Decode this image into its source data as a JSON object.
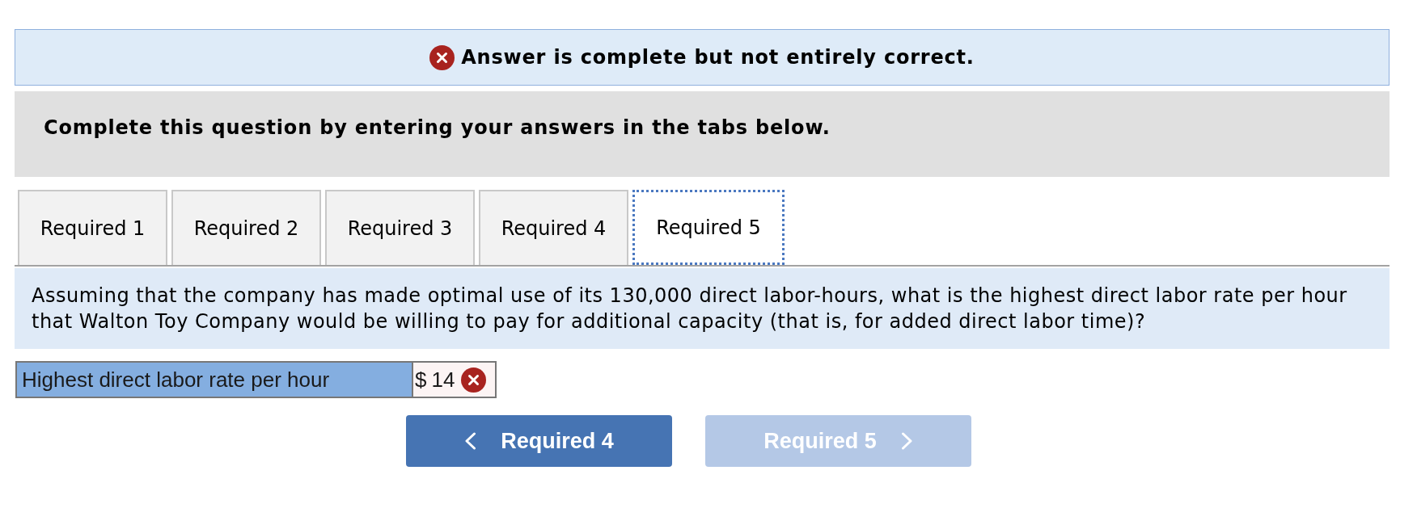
{
  "feedback_banner": {
    "correct": false,
    "message": "Answer is complete but not entirely correct."
  },
  "instructions": "Complete this question by entering your answers in the tabs below.",
  "tabs": [
    {
      "label": "Required 1",
      "selected": false
    },
    {
      "label": "Required 2",
      "selected": false
    },
    {
      "label": "Required 3",
      "selected": false
    },
    {
      "label": "Required 4",
      "selected": false
    },
    {
      "label": "Required 5",
      "selected": true
    }
  ],
  "question": "Assuming that the company has made optimal use of its 130,000 direct labor-hours, what is the highest direct labor rate per hour that Walton Toy Company would be willing to pay for additional capacity (that is, for added direct labor time)?",
  "answer_row": {
    "label": "Highest direct labor rate per hour",
    "currency": "$",
    "value": "14",
    "correct": false
  },
  "nav_buttons": [
    {
      "kind": "previous",
      "label": "Required 4",
      "disabled": false
    },
    {
      "kind": "next",
      "label": "Required 5",
      "disabled": true
    }
  ]
}
